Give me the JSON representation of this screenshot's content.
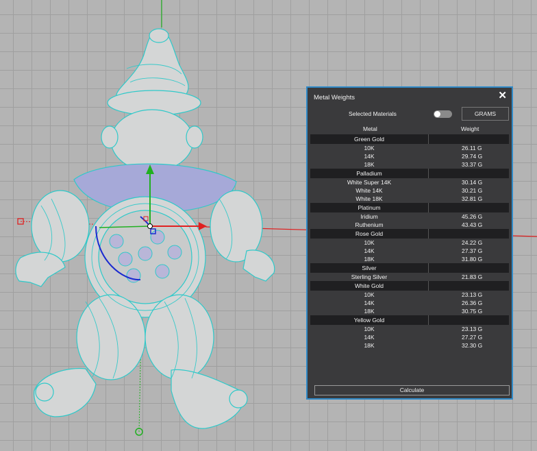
{
  "panel": {
    "title": "Metal Weights",
    "close_icon": "close-icon",
    "selected_materials_label": "Selected Materials",
    "units_button": "GRAMS",
    "col_metal": "Metal",
    "col_weight": "Weight",
    "calculate_label": "Calculate"
  },
  "groups": [
    {
      "name": "Green Gold",
      "items": [
        {
          "metal": "10K",
          "weight": "26.11 G"
        },
        {
          "metal": "14K",
          "weight": "29.74 G"
        },
        {
          "metal": "18K",
          "weight": "33.37 G"
        }
      ]
    },
    {
      "name": "Palladium",
      "items": [
        {
          "metal": "White Super 14K",
          "weight": "30.14 G"
        },
        {
          "metal": "White 14K",
          "weight": "30.21 G"
        },
        {
          "metal": "White 18K",
          "weight": "32.81 G"
        }
      ]
    },
    {
      "name": "Platinum",
      "items": [
        {
          "metal": "Iridium",
          "weight": "45.26 G"
        },
        {
          "metal": "Ruthenium",
          "weight": "43.43 G"
        }
      ]
    },
    {
      "name": "Rose Gold",
      "items": [
        {
          "metal": "10K",
          "weight": "24.22 G"
        },
        {
          "metal": "14K",
          "weight": "27.37 G"
        },
        {
          "metal": "18K",
          "weight": "31.80 G"
        }
      ]
    },
    {
      "name": "Silver",
      "items": [
        {
          "metal": "Sterling Silver",
          "weight": "21.83 G"
        }
      ]
    },
    {
      "name": "White Gold",
      "items": [
        {
          "metal": "10K",
          "weight": "23.13 G"
        },
        {
          "metal": "14K",
          "weight": "26.36 G"
        },
        {
          "metal": "18K",
          "weight": "30.75 G"
        }
      ]
    },
    {
      "name": "Yellow Gold",
      "items": [
        {
          "metal": "10K",
          "weight": "23.13 G"
        },
        {
          "metal": "14K",
          "weight": "27.27 G"
        },
        {
          "metal": "18K",
          "weight": "32.30 G"
        }
      ]
    }
  ],
  "colors": {
    "panel_bg": "#3a3a3c",
    "panel_border": "#2f8ac8",
    "group_row_bg": "#1f1f21",
    "model_wire": "#2ec9c9",
    "axis_x": "#e02020",
    "axis_y": "#20b020",
    "gumball_blue": "#1a2ad0"
  }
}
